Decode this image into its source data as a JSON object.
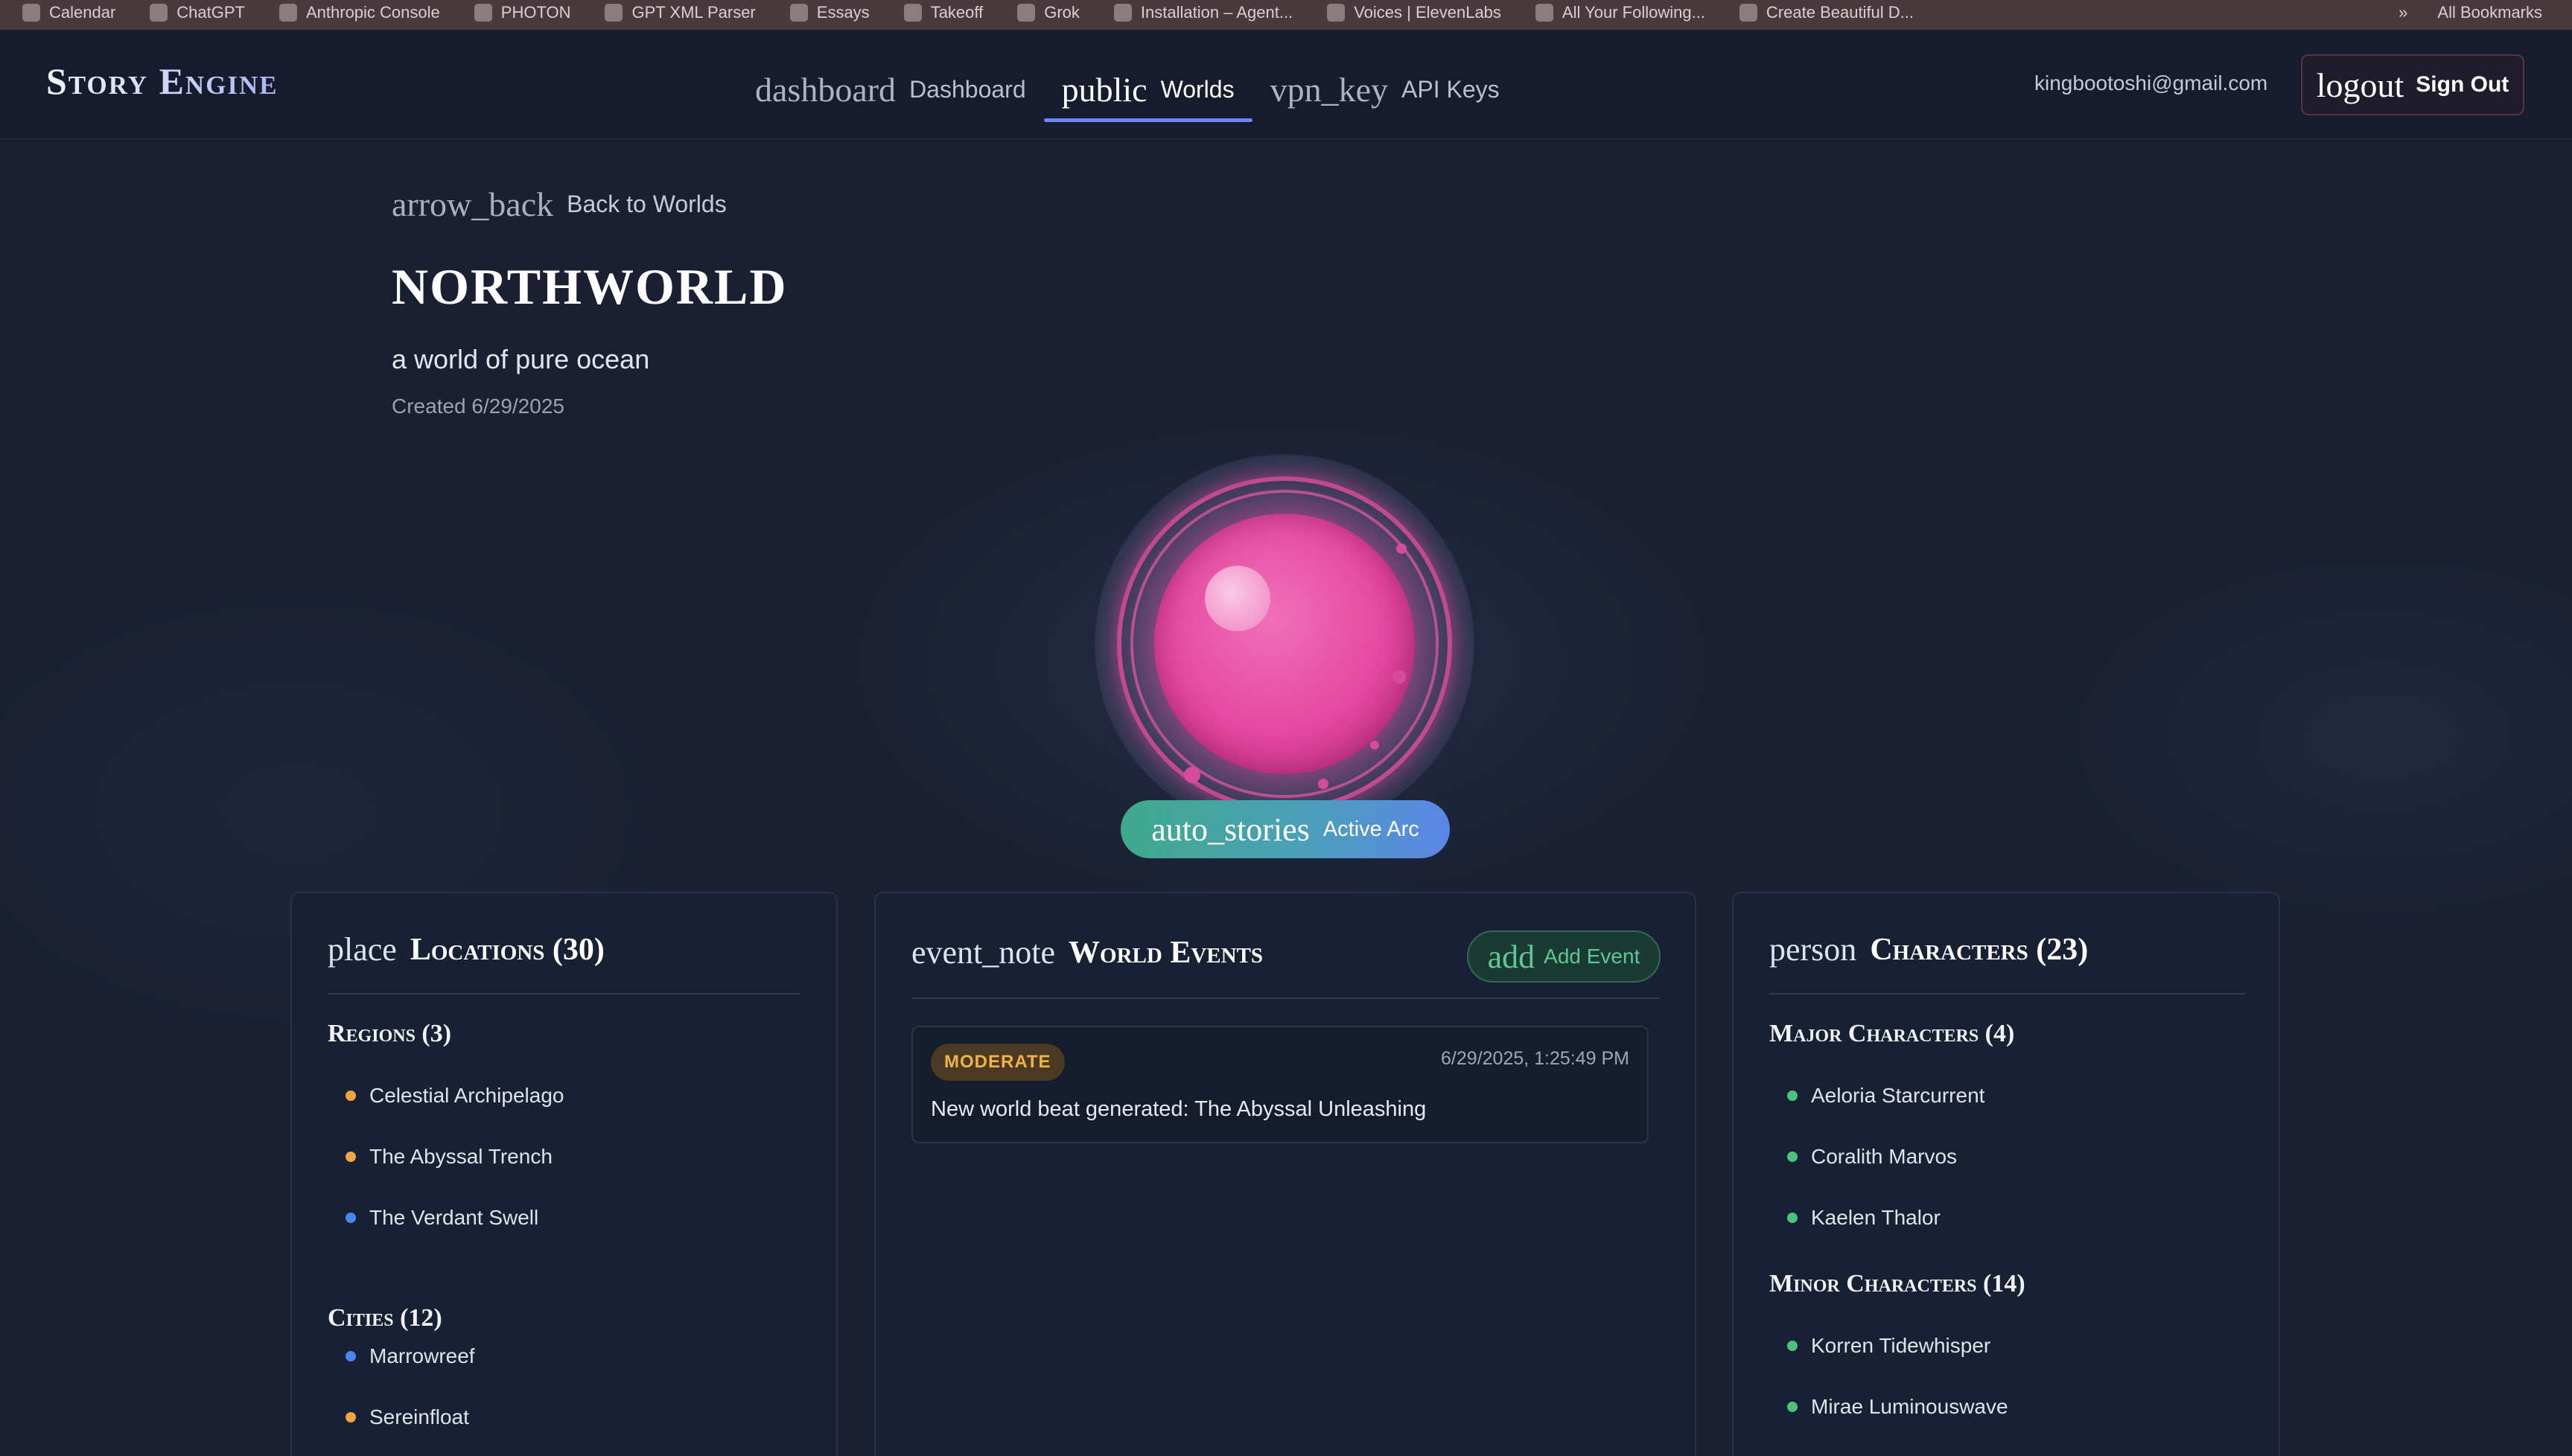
{
  "browser": {
    "bookmarks": [
      "Calendar",
      "ChatGPT",
      "Anthropic Console",
      "PHOTON",
      "GPT XML Parser",
      "Essays",
      "Takeoff",
      "Grok",
      "Installation – Agent...",
      "Voices | ElevenLabs",
      "All Your Following...",
      "Create Beautiful D..."
    ],
    "all_bookmarks_label": "All Bookmarks"
  },
  "header": {
    "logo": "Story Engine",
    "nav": [
      {
        "icon": "dashboard",
        "label": "Dashboard",
        "active": false
      },
      {
        "icon": "public",
        "label": "Worlds",
        "active": true
      },
      {
        "icon": "vpn_key",
        "label": "API Keys",
        "active": false
      }
    ],
    "user_email": "kingbootoshi@gmail.com",
    "signout": {
      "icon": "logout",
      "label": "Sign Out"
    }
  },
  "world": {
    "back": {
      "icon": "arrow_back",
      "label": "Back to Worlds"
    },
    "title": "NORTHWORLD",
    "description": "a world of pure ocean",
    "created": "Created 6/29/2025",
    "arc_badge": {
      "icon": "auto_stories",
      "label": "Active Arc"
    }
  },
  "locations": {
    "icon": "place",
    "title": "Locations (30)",
    "groups": [
      {
        "title": "Regions (3)",
        "items": [
          {
            "name": "Celestial Archipelago",
            "color": "#f0a540"
          },
          {
            "name": "The Abyssal Trench",
            "color": "#f0a540"
          },
          {
            "name": "The Verdant Swell",
            "color": "#4a86f0"
          }
        ]
      },
      {
        "title": "Cities (12)",
        "items": [
          {
            "name": "Marrowreef",
            "color": "#4a86f0"
          },
          {
            "name": "Sereinfloat",
            "color": "#f0a540"
          }
        ]
      }
    ]
  },
  "events": {
    "icon": "event_note",
    "title": "World Events",
    "add": {
      "icon": "add",
      "label": "Add Event"
    },
    "items": [
      {
        "severity": "MODERATE",
        "time": "6/29/2025, 1:25:49 PM",
        "text": "New world beat generated: The Abyssal Unleashing"
      }
    ]
  },
  "characters": {
    "icon": "person",
    "title": "Characters (23)",
    "groups": [
      {
        "title": "Major Characters (4)",
        "items": [
          {
            "name": "Aeloria Starcurrent",
            "color": "#4cc27f"
          },
          {
            "name": "Coralith Marvos",
            "color": "#4cc27f"
          },
          {
            "name": "Kaelen Thalor",
            "color": "#4cc27f"
          }
        ]
      },
      {
        "title": "Minor Characters (14)",
        "items": [
          {
            "name": "Korren Tidewhisper",
            "color": "#4cc27f"
          },
          {
            "name": "Mirae Luminouswave",
            "color": "#4cc27f"
          }
        ]
      }
    ]
  }
}
